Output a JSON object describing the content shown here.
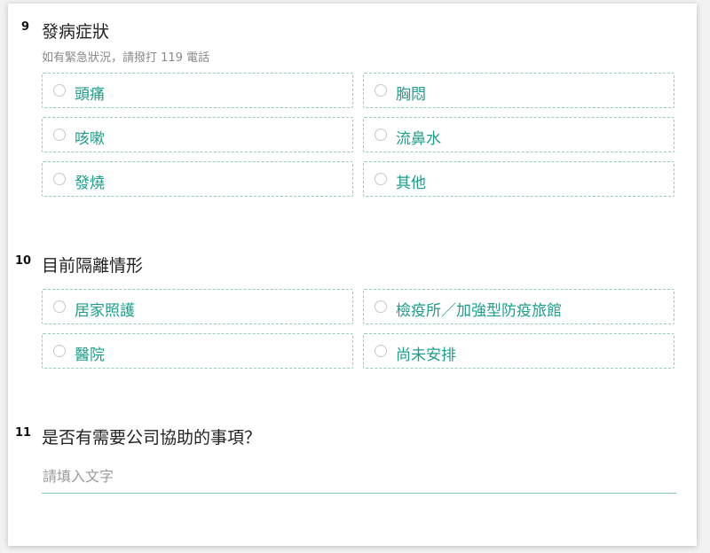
{
  "questions": {
    "q9": {
      "number": "9",
      "title": "發病症狀",
      "hint": "如有緊急狀況，請撥打 119 電話",
      "options": [
        "頭痛",
        "胸悶",
        "咳嗽",
        "流鼻水",
        "發燒",
        "其他"
      ]
    },
    "q10": {
      "number": "10",
      "title": "目前隔離情形",
      "options": [
        "居家照護",
        "檢疫所／加強型防疫旅館",
        "醫院",
        "尚未安排"
      ]
    },
    "q11": {
      "number": "11",
      "title": "是否有需要公司協助的事項？",
      "input_value": "",
      "input_placeholder": "請填入文字"
    }
  },
  "colors": {
    "accent": "#1e9e8a",
    "option_border": "#93cdbd",
    "input_underline": "#7fc9b6"
  }
}
